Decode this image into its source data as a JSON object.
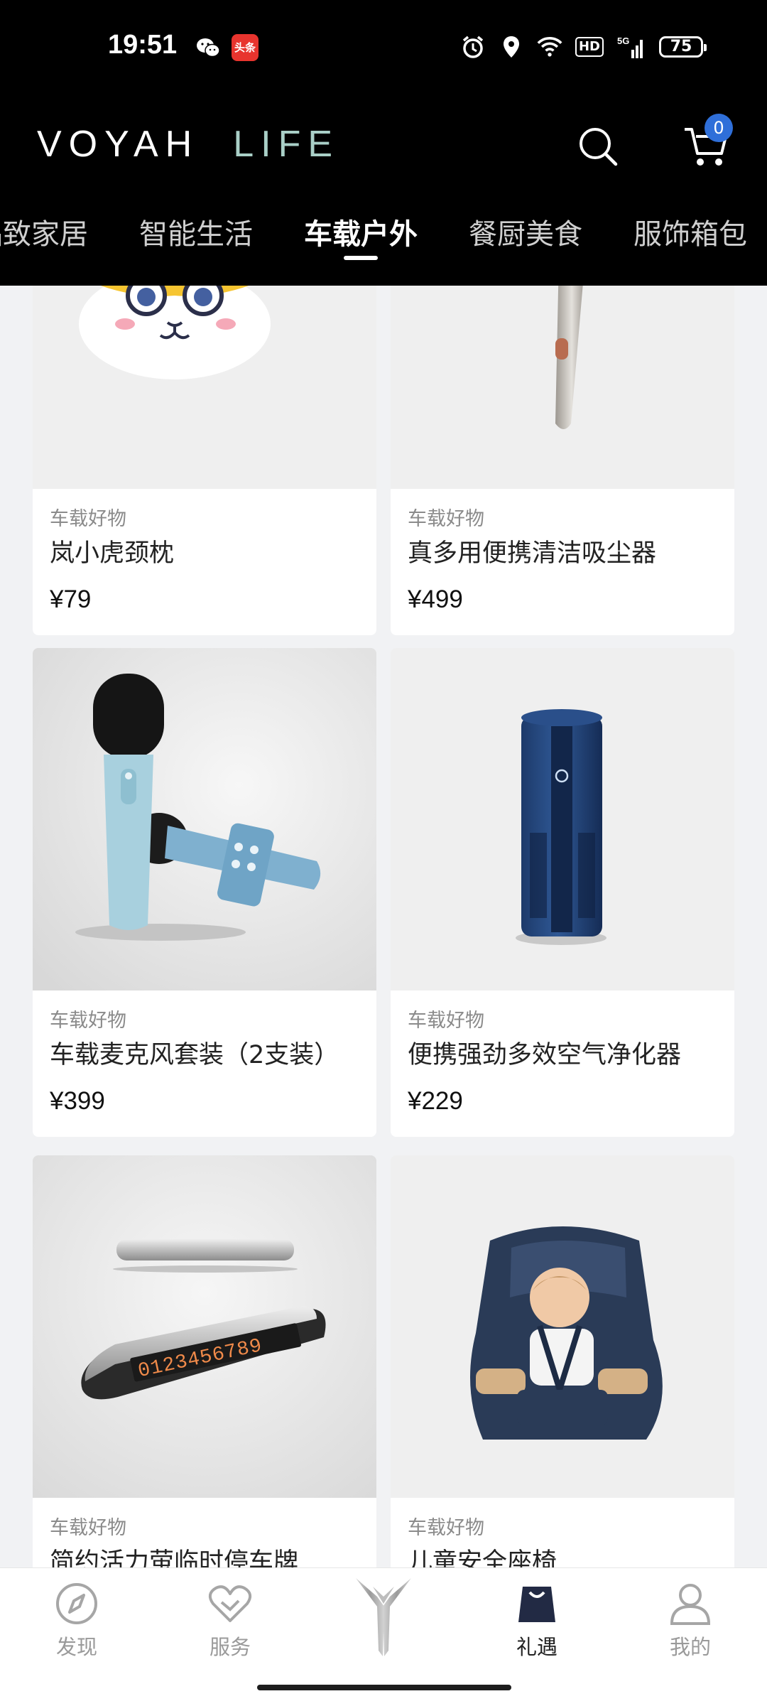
{
  "status_bar": {
    "time": "19:51",
    "toutiao_label": "头条",
    "hd_label": "HD",
    "network_label": "5G",
    "battery": "75"
  },
  "header": {
    "logo_primary": "VOYAH",
    "logo_secondary": "LIFE",
    "cart_count": "0"
  },
  "tabs": [
    {
      "label": "品致家居",
      "active": false
    },
    {
      "label": "智能生活",
      "active": false
    },
    {
      "label": "车载户外",
      "active": true
    },
    {
      "label": "餐厨美食",
      "active": false
    },
    {
      "label": "服饰箱包",
      "active": false
    }
  ],
  "products": [
    {
      "category": "车载好物",
      "name": "岚小虎颈枕",
      "price": "¥79"
    },
    {
      "category": "车载好物",
      "name": "真多用便携清洁吸尘器",
      "price": "¥499"
    },
    {
      "category": "车载好物",
      "name": "车载麦克风套装（2支装）",
      "price": "¥399"
    },
    {
      "category": "车载好物",
      "name": "便携强劲多效空气净化器",
      "price": "¥229"
    },
    {
      "category": "车载好物",
      "name": "简约活力萤临时停车牌",
      "price": ""
    },
    {
      "category": "车载好物",
      "name": "儿童安全座椅",
      "price": ""
    }
  ],
  "parking_sign_digits": "0123456789",
  "bottom_nav": [
    {
      "label": "发现",
      "icon": "compass-icon",
      "active": false
    },
    {
      "label": "服务",
      "icon": "heart-icon",
      "active": false
    },
    {
      "label": "",
      "icon": "voyah-emblem-icon",
      "active": false
    },
    {
      "label": "礼遇",
      "icon": "gift-bag-icon",
      "active": true
    },
    {
      "label": "我的",
      "icon": "profile-icon",
      "active": false
    }
  ],
  "colors": {
    "header_bg": "#000000",
    "logo_accent": "#a9cfc7",
    "badge": "#2f6fd9",
    "page_bg": "#f1f2f4"
  }
}
